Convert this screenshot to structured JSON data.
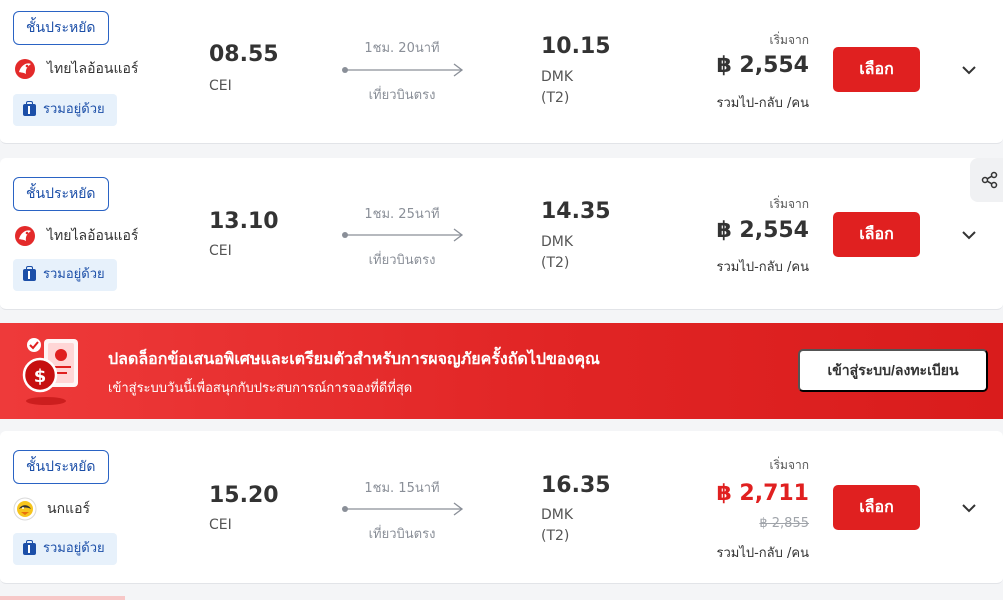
{
  "flights": [
    {
      "badge": "ชั้นประหยัด",
      "airline": "ไทยไลอ้อนแอร์",
      "airline_logo": "thai-lion-air-logo",
      "bundle": "รวมอยู่ด้วย",
      "depart_time": "08.55",
      "depart_airport": "CEI",
      "duration": "1ชม. 20นาที",
      "stops": "เที่ยวบินตรง",
      "arrive_time": "10.15",
      "arrive_airport": "DMK",
      "arrive_terminal": "(T2)",
      "from_label": "เริ่มจาก",
      "price": "฿ 2,554",
      "old_price": "",
      "per": "รวมไป-กลับ /คน",
      "select_label": "เลือก"
    },
    {
      "badge": "ชั้นประหยัด",
      "airline": "ไทยไลอ้อนแอร์",
      "airline_logo": "thai-lion-air-logo",
      "bundle": "รวมอยู่ด้วย",
      "depart_time": "13.10",
      "depart_airport": "CEI",
      "duration": "1ชม. 25นาที",
      "stops": "เที่ยวบินตรง",
      "arrive_time": "14.35",
      "arrive_airport": "DMK",
      "arrive_terminal": "(T2)",
      "from_label": "เริ่มจาก",
      "price": "฿ 2,554",
      "old_price": "",
      "per": "รวมไป-กลับ /คน",
      "select_label": "เลือก"
    },
    {
      "badge": "ชั้นประหยัด",
      "airline": "นกแอร์",
      "airline_logo": "nok-air-logo",
      "bundle": "รวมอยู่ด้วย",
      "depart_time": "15.20",
      "depart_airport": "CEI",
      "duration": "1ชม. 15นาที",
      "stops": "เที่ยวบินตรง",
      "arrive_time": "16.35",
      "arrive_airport": "DMK",
      "arrive_terminal": "(T2)",
      "from_label": "เริ่มจาก",
      "price": "฿ 2,711",
      "old_price": "฿ 2,855",
      "per": "รวมไป-กลับ /คน",
      "select_label": "เลือก"
    }
  ],
  "promo": {
    "title": "ปลดล็อกข้อเสนอพิเศษและเตรียมตัวสำหรับการผจญภัยครั้งถัดไปของคุณ",
    "subtitle": "เข้าสู่ระบบวันนี้เพื่อสนุกกับประสบการณ์การจองที่ดีที่สุด",
    "button": "เข้าสู่ระบบ/ลงทะเบียน"
  },
  "colors": {
    "accent_red": "#e02020",
    "brand_blue": "#1c4fa8",
    "bundle_bg": "#e7f1fb"
  },
  "icons": {
    "share": "share-icon",
    "chevron": "chevron-down-icon",
    "bag": "luggage-icon"
  }
}
